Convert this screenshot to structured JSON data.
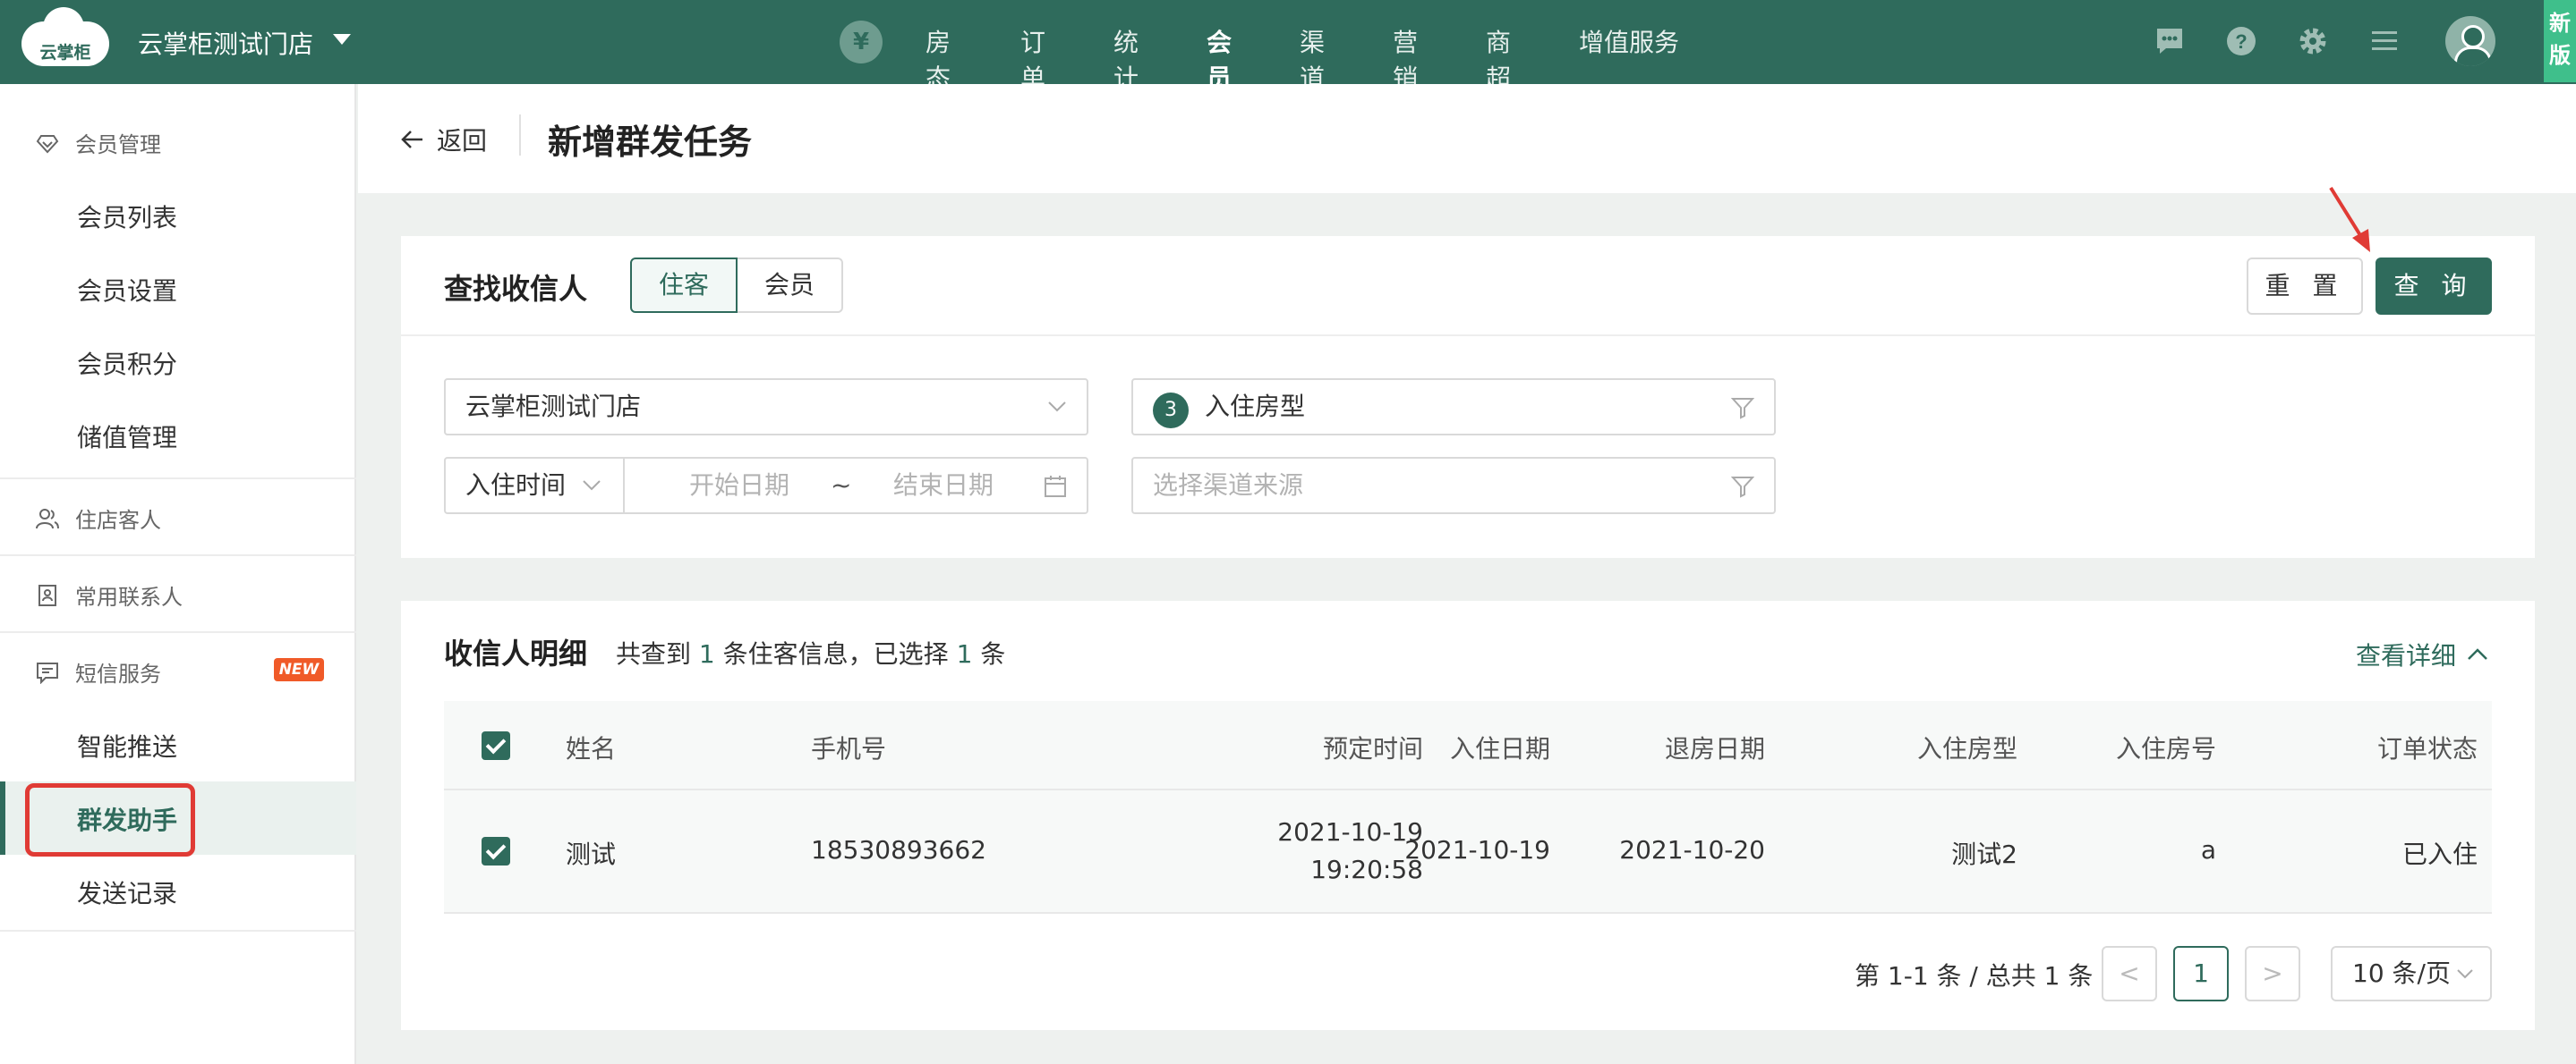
{
  "colors": {
    "primary": "#2f6b5c",
    "accent_new": "#f05a28",
    "highlight": "#e03b35"
  },
  "topbar": {
    "logo_text": "云掌柜",
    "store_name": "云掌柜测试门店",
    "currency_symbol": "¥",
    "nav": [
      "房态",
      "订单",
      "统计",
      "会员",
      "渠道",
      "营销",
      "商超",
      "增值服务"
    ],
    "active_nav": "会员",
    "icons": [
      "message-icon",
      "help-icon",
      "settings-icon",
      "menu-icon",
      "user-avatar-icon"
    ],
    "new_version": "新版"
  },
  "sidebar": {
    "member_mgmt": "会员管理",
    "member_items": [
      "会员列表",
      "会员设置",
      "会员积分",
      "储值管理"
    ],
    "guests": "住店客人",
    "contacts": "常用联系人",
    "sms": "短信服务",
    "sms_badge": "NEW",
    "sms_items": [
      "智能推送",
      "群发助手",
      "发送记录"
    ],
    "active_item": "群发助手"
  },
  "header": {
    "back": "返回",
    "title": "新增群发任务"
  },
  "search": {
    "title": "查找收信人",
    "tabs": [
      "住客",
      "会员"
    ],
    "active_tab": "住客",
    "reset": "重 置",
    "query": "查 询",
    "store_select": "云掌柜测试门店",
    "room_type_count": "3",
    "room_type_label": "入住房型",
    "date_type": "入住时间",
    "start_placeholder": "开始日期",
    "date_sep": "~",
    "end_placeholder": "结束日期",
    "channel_placeholder": "选择渠道来源"
  },
  "recipients": {
    "title": "收信人明细",
    "summary_prefix": "共查到",
    "found": "1",
    "summary_mid": "条住客信息，已选择",
    "selected": "1",
    "summary_suffix": "条",
    "detail_link": "查看详细",
    "columns": [
      "姓名",
      "手机号",
      "预定时间",
      "入住日期",
      "退房日期",
      "入住房型",
      "入住房号",
      "订单状态"
    ],
    "rows": [
      {
        "name": "测试",
        "phone": "18530893662",
        "booking_date": "2021-10-19",
        "booking_time": "19:20:58",
        "checkin": "2021-10-19",
        "checkout": "2021-10-20",
        "room_type": "测试2",
        "room_no": "a",
        "status": "已入住"
      }
    ]
  },
  "pagination": {
    "summary": "第 1-1 条 / 总共 1 条",
    "prev": "<",
    "current": "1",
    "next": ">",
    "page_size": "10 条/页"
  }
}
